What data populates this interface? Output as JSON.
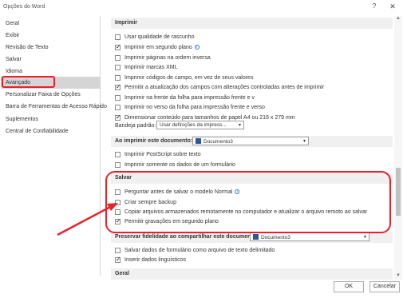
{
  "window": {
    "title": "Opções do Word",
    "help_label": "?",
    "close_label": "✕"
  },
  "sidebar": {
    "items": [
      {
        "label": "Geral"
      },
      {
        "label": "Exibir"
      },
      {
        "label": "Revisão de Texto"
      },
      {
        "label": "Salvar"
      },
      {
        "label": "Idioma"
      },
      {
        "label": "Avançado"
      },
      {
        "label": "Personalizar Faixa de Opções"
      },
      {
        "label": "Barra de Ferramentas de Acesso Rápido"
      },
      {
        "label": "Suplementos"
      },
      {
        "label": "Central de Confiabilidade"
      }
    ],
    "selected": "Avançado"
  },
  "imprimir": {
    "heading": "Imprimir",
    "options": [
      {
        "label": "Usar qualidade de rascunho",
        "checked": false
      },
      {
        "label": "Imprimir em segundo plano",
        "checked": true
      },
      {
        "label": "Imprimir páginas na ordem inversa",
        "checked": false
      },
      {
        "label": "Imprimir marcas XML",
        "checked": false
      },
      {
        "label": "Imprimir códigos de campo, em vez de seus valores",
        "checked": false
      },
      {
        "label": "Permitir a atualização dos campos com alterações controladas antes de imprimir",
        "checked": true
      },
      {
        "label": "Imprimir na frente da folha para impressão frente e v",
        "checked": false
      },
      {
        "label": "Imprimir no verso da folha para impressão frente e verso",
        "checked": false
      },
      {
        "label": "Dimensionar conteúdo para tamanhos de papel A4 ou 216 x 279 mm",
        "checked": true
      }
    ],
    "tray_label": "Bandeja padrão:",
    "tray_value": "Usar definições da impress..."
  },
  "ao_imprimir": {
    "label": "Ao imprimir este documento:",
    "document": "Documento3",
    "options": [
      {
        "label": "Imprimir PostScript sobre texto",
        "checked": false
      },
      {
        "label": "Imprimir somente os dados de um formulário",
        "checked": false
      }
    ]
  },
  "salvar": {
    "heading": "Salvar",
    "options": [
      {
        "label": "Perguntar antes de salvar o modelo Normal",
        "checked": false
      },
      {
        "label": "Criar sempre backup",
        "checked": false
      },
      {
        "label": "Copiar arquivos armazenados remotamente no computador e atualizar o arquivo remoto ao salvar",
        "checked": false
      },
      {
        "label": "Permitir gravações em segundo plano",
        "checked": true
      }
    ]
  },
  "fidelidade": {
    "label": "Preservar fidelidade ao compartilhar este documento:",
    "document": "Documento3",
    "options": [
      {
        "label": "Salvar dados de formulário como arquivo de texto delimitado",
        "checked": false
      },
      {
        "label": "Inserir dados linguísticos",
        "checked": true
      }
    ]
  },
  "geral": {
    "heading": "Geral"
  },
  "buttons": {
    "ok": "OK",
    "cancel": "Cancelar"
  },
  "colors": {
    "annotation": "#e8202a",
    "selected_bg": "#d5d5d5",
    "section_bg": "#f0f0f0"
  }
}
